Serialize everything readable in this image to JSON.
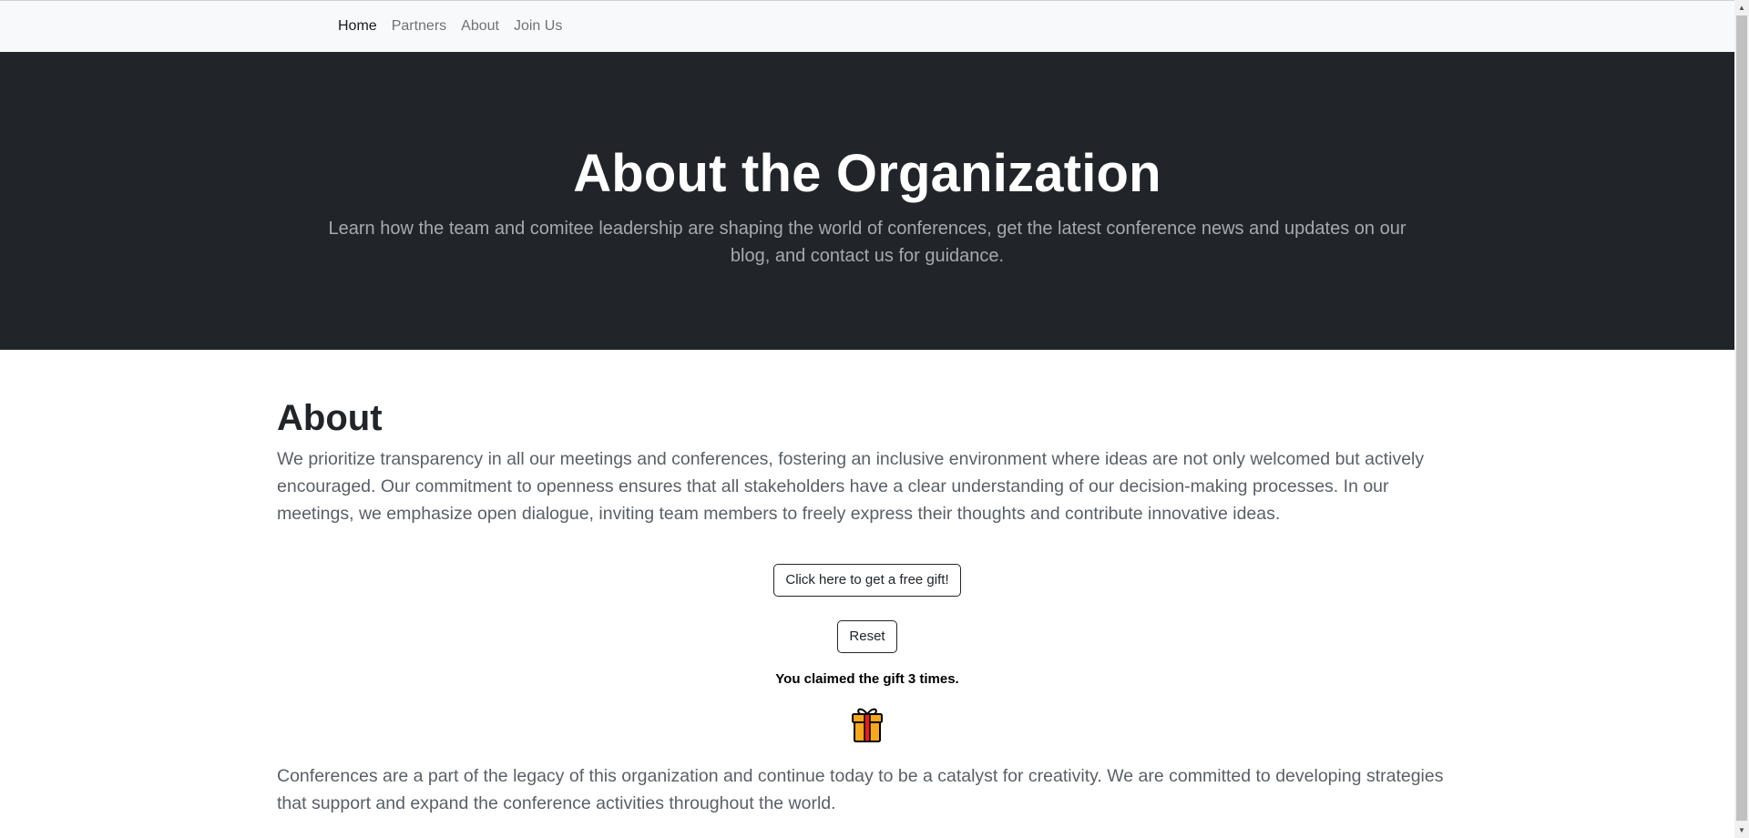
{
  "nav": {
    "items": [
      {
        "label": "Home",
        "active": true
      },
      {
        "label": "Partners",
        "active": false
      },
      {
        "label": "About",
        "active": false
      },
      {
        "label": "Join Us",
        "active": false
      }
    ]
  },
  "hero": {
    "title": "About the Organization",
    "lead": "Learn how the team and comitee leadership are shaping the world of conferences, get the latest conference news and updates on our blog, and contact us for guidance."
  },
  "about": {
    "heading": "About",
    "paragraph": "We prioritize transparency in all our meetings and conferences, fostering an inclusive environment where ideas are not only welcomed but actively encouraged. Our commitment to openness ensures that all stakeholders have a clear understanding of our decision-making processes. In our meetings, we emphasize open dialogue, inviting team members to freely express their thoughts and contribute innovative ideas.",
    "gift_button": "Click here to get a free gift!",
    "reset_button": "Reset",
    "claim_message": "You claimed the gift 3 times.",
    "gift_icon": "gift-icon",
    "closing_paragraph": "Conferences are a part of the legacy of this organization and continue today to be a catalyst for creativity. We are committed to developing strategies that support and expand the conference activities throughout the world."
  },
  "colors": {
    "hero_bg": "#212529",
    "navbar_bg": "#f8f9fa",
    "gift_body": "#f5a623",
    "gift_ribbon": "#d8231f"
  }
}
